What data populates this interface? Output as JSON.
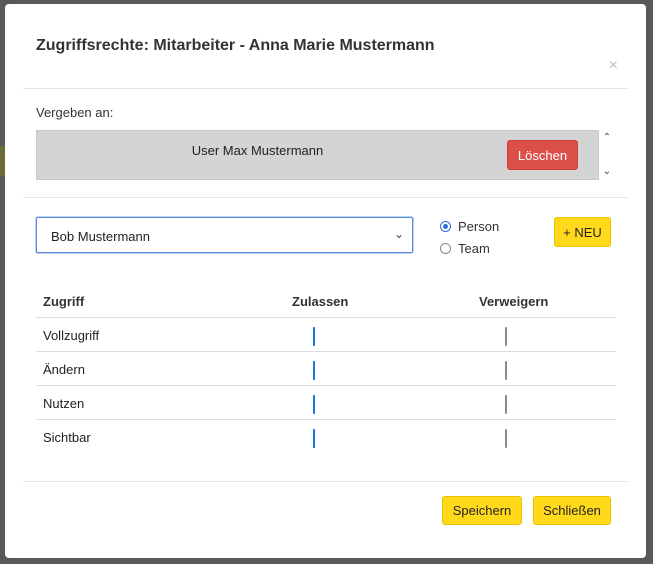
{
  "dialog": {
    "title": "Zugriffsrechte: Mitarbeiter - Anna Marie Mustermann",
    "close_glyph": "×"
  },
  "assigned": {
    "label": "Vergeben an:",
    "user": "User Max Mustermann",
    "delete_label": "Löschen",
    "scroll_up_glyph": "⌃",
    "scroll_down_glyph": "⌄"
  },
  "picker": {
    "selected": "Bob Mustermann",
    "chevron": "⌄",
    "options": [
      {
        "label": "Person",
        "checked": true
      },
      {
        "label": "Team",
        "checked": false
      }
    ],
    "new_label": "+ NEU"
  },
  "permissions": {
    "headers": [
      "Zugriff",
      "Zulassen",
      "Verweigern"
    ],
    "rows": [
      {
        "name": "Vollzugriff",
        "allow": true,
        "deny": false
      },
      {
        "name": "Ändern",
        "allow": true,
        "deny": false
      },
      {
        "name": "Nutzen",
        "allow": true,
        "deny": false
      },
      {
        "name": "Sichtbar",
        "allow": true,
        "deny": false
      }
    ]
  },
  "footer": {
    "save_label": "Speichern",
    "close_label": "Schließen"
  },
  "colors": {
    "accent_yellow": "#ffd91a",
    "danger_red": "#dc4f48",
    "checkbox_blue": "#1a73e8",
    "overlay": "#595959"
  }
}
